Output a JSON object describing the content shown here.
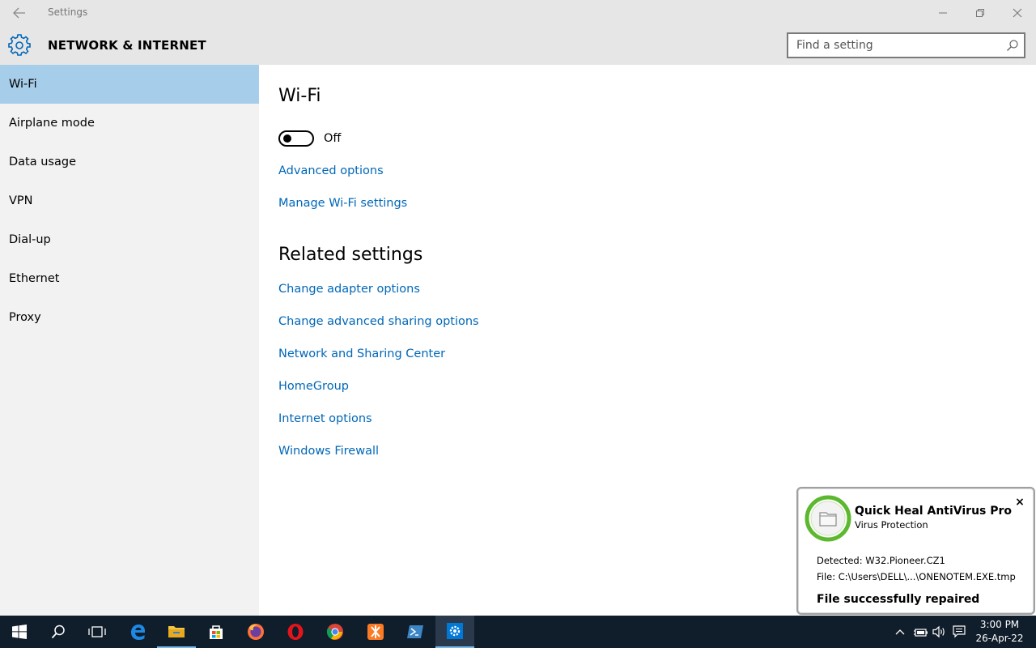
{
  "window": {
    "app_title": "Settings",
    "section_title": "NETWORK & INTERNET"
  },
  "search": {
    "placeholder": "Find a setting"
  },
  "sidebar": {
    "items": [
      {
        "label": "Wi-Fi",
        "active": true
      },
      {
        "label": "Airplane mode",
        "active": false
      },
      {
        "label": "Data usage",
        "active": false
      },
      {
        "label": "VPN",
        "active": false
      },
      {
        "label": "Dial-up",
        "active": false
      },
      {
        "label": "Ethernet",
        "active": false
      },
      {
        "label": "Proxy",
        "active": false
      }
    ]
  },
  "main": {
    "heading": "Wi-Fi",
    "toggle": {
      "state": "off",
      "label": "Off"
    },
    "links": [
      {
        "label": "Advanced options"
      },
      {
        "label": "Manage Wi-Fi settings"
      }
    ],
    "related_heading": "Related settings",
    "related_links": [
      {
        "label": "Change adapter options"
      },
      {
        "label": "Change advanced sharing options"
      },
      {
        "label": "Network and Sharing Center"
      },
      {
        "label": "HomeGroup"
      },
      {
        "label": "Internet options"
      },
      {
        "label": "Windows Firewall"
      }
    ]
  },
  "notification": {
    "title": "Quick Heal AntiVirus Pro",
    "subtitle": "Virus Protection",
    "detected": "Detected: W32.Pioneer.CZ1",
    "file": "File: C:\\Users\\DELL\\...\\ONENOTEM.EXE.tmp",
    "status": "File successfully repaired",
    "close_glyph": "×"
  },
  "taskbar": {
    "apps": [
      "windows-start-icon",
      "search-icon",
      "task-view-icon",
      "edge-icon",
      "file-explorer-icon",
      "store-icon",
      "firefox-icon",
      "opera-icon",
      "chrome-icon",
      "xampp-icon",
      "powershell-icon",
      "settings-icon"
    ],
    "clock": {
      "time": "3:00 PM",
      "date": "26-Apr-22"
    }
  },
  "colors": {
    "accent": "#0067b8",
    "sidebar_active": "#a6cde9",
    "header_bg": "#e6e6e6",
    "sidebar_bg": "#f2f2f2",
    "taskbar_bg": "#101d2b",
    "antivirus_green": "#5cb82e"
  }
}
